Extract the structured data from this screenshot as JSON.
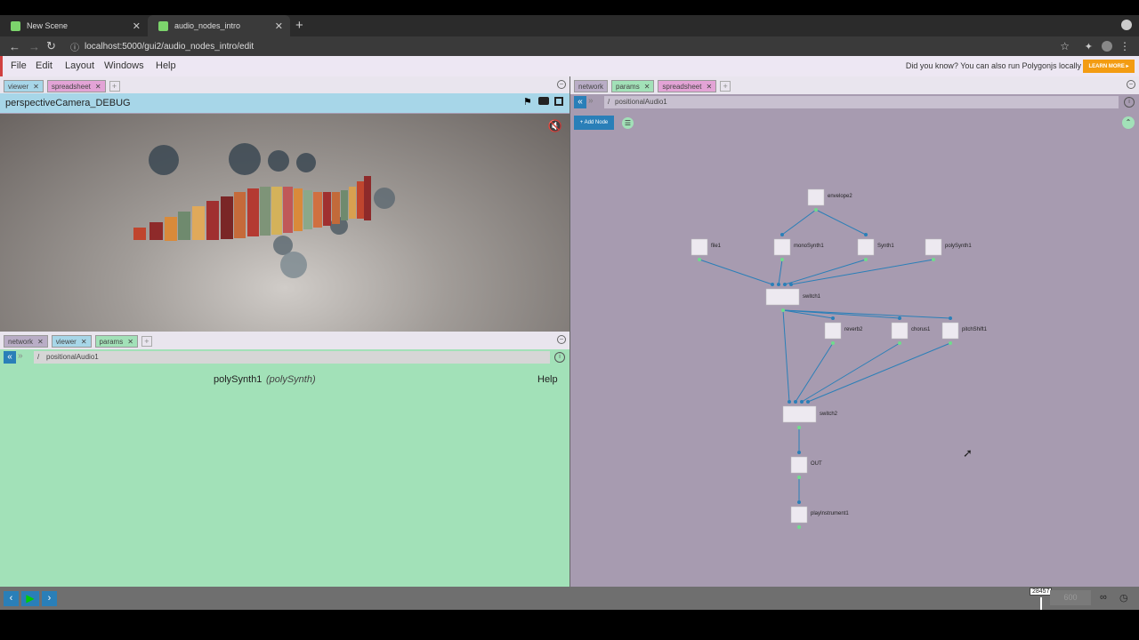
{
  "browser": {
    "tabs": [
      {
        "title": "New Scene"
      },
      {
        "title": "audio_nodes_intro"
      }
    ],
    "url": "localhost:5000/gui2/audio_nodes_intro/edit"
  },
  "menu": {
    "items": [
      "File",
      "Edit",
      "Layout",
      "Windows",
      "Help"
    ],
    "tip": "Did you know? You can also run Polygonjs locally",
    "learn_more": "LEARN MORE ▸"
  },
  "left_top_tabs": [
    "viewer",
    "spreadsheet"
  ],
  "viewer": {
    "camera": "perspectiveCamera_DEBUG"
  },
  "left_bottom_tabs": [
    "network",
    "viewer",
    "params"
  ],
  "params": {
    "path_sep": "/",
    "path": "positionalAudio1",
    "node_name": "polySynth1",
    "node_type": "(polySynth)",
    "help": "Help"
  },
  "right_tabs": [
    "network",
    "params",
    "spreadsheet"
  ],
  "network": {
    "path_sep": "/",
    "path": "positionalAudio1",
    "add_node": "+ Add Node"
  },
  "nodes": [
    {
      "id": "envelope2",
      "label": "envelope2"
    },
    {
      "id": "file1",
      "label": "file1"
    },
    {
      "id": "monoSynth1",
      "label": "monoSynth1"
    },
    {
      "id": "Synth1",
      "label": "Synth1"
    },
    {
      "id": "polySynth1",
      "label": "polySynth1"
    },
    {
      "id": "switch1",
      "label": "switch1"
    },
    {
      "id": "reverb2",
      "label": "reverb2"
    },
    {
      "id": "chorus1",
      "label": "chorus1"
    },
    {
      "id": "pitchShift1",
      "label": "pitchShift1"
    },
    {
      "id": "switch2",
      "label": "switch2"
    },
    {
      "id": "OUT",
      "label": "OUT"
    },
    {
      "id": "playInstrument1",
      "label": "playInstrument1"
    }
  ],
  "timeline": {
    "frame": "28457",
    "end": "600"
  },
  "colors": {
    "viewer_header": "#a7d6e8",
    "params_bg": "#a2e1b8",
    "network_bg": "#a79bb0",
    "accent": "#2a7fb8"
  }
}
